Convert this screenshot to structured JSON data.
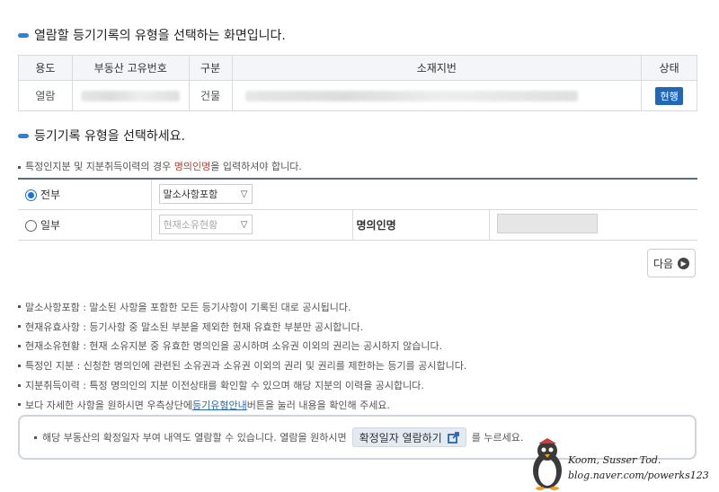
{
  "header": {
    "title": "열람할 등기기록의 유형을 선택하는 화면입니다."
  },
  "info_table": {
    "columns": [
      "용도",
      "부동산 고유번호",
      "구분",
      "소재지번",
      "상태"
    ],
    "row": {
      "usage": "열람",
      "category": "건물",
      "status_badge": "현행"
    }
  },
  "select_section": {
    "title": "등기기록 유형을 선택하세요.",
    "note_before": "특정인지분 및 지분취득이력의 경우 ",
    "note_highlight": "명의인명",
    "note_after": "을 입력하셔야 합니다.",
    "options": [
      {
        "label": "전부",
        "selected": true,
        "select_value": "말소사항포함",
        "enabled": true
      },
      {
        "label": "일부",
        "selected": false,
        "select_value": "현재소유현황",
        "enabled": false
      }
    ],
    "name_label": "명의인명",
    "next_label": "다음"
  },
  "descriptions": [
    "말소사항포함 : 말소된 사항을 포함한 모든 등기사항이 기록된 대로 공시됩니다.",
    "현재유효사항 : 등기사항 중 말소된 부분을 제외한 현재 유효한 부분만 공시합니다.",
    "현재소유현황 : 현재 소유지분 중 유효한 명의인을 공시하며 소유권 이외의 권리는 공시하지 않습니다.",
    "특정인 지분 : 신청한 명의인에 관련된 소유권과 소유권 이외의 권리 및 권리를 제한하는 등기를 공시합니다.",
    "지분취득이력 : 특정 명의인의 지분 이전상태를 확인할 수 있으며 해당 지분의 이력을 공시합니다."
  ],
  "guide_line": {
    "before": "보다 자세한 사항을 원하시면 우측상단에 ",
    "link": "등기유형안내",
    "after": "버튼을 눌러 내용을 확인해 주세요."
  },
  "notice": {
    "before": "해당 부동산의 확정일자 부여 내역도 열람할 수 있습니다. 열람을 원하시면",
    "button_label": "확정일자 열람하기",
    "after": "를 누르세요.",
    "after_visible": "르세요."
  },
  "watermark": {
    "line1": "Koom, Susser Tod.",
    "line2": "blog.naver.com/powerks123"
  },
  "colors": {
    "accent": "#2b82d6",
    "badge": "#2266b8",
    "highlight": "#c0392b"
  }
}
